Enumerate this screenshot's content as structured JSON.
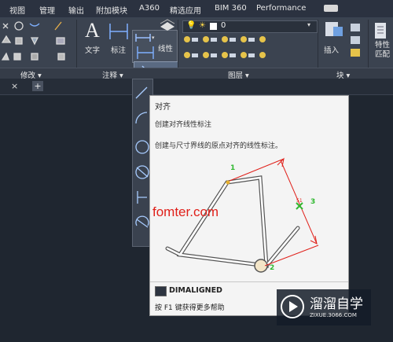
{
  "menu_tabs": [
    "视图",
    "管理",
    "输出",
    "附加模块",
    "A360",
    "精选应用",
    "BIM 360",
    "Performance"
  ],
  "ribbon": {
    "panels": [
      {
        "label": "修改 ▾"
      },
      {
        "label": "注释 ▾"
      },
      {
        "label": "图层 ▾"
      },
      {
        "label": "块 ▾"
      }
    ],
    "text_label": "文字",
    "dim_label": "标注",
    "linear_label": "线性",
    "align_label": "对齐",
    "insert_label": "插入",
    "props_label": "特性\n匹配",
    "layer_current": "0"
  },
  "doc_tab_close": "×",
  "doc_tab_add": "+",
  "tooltip": {
    "title": "对齐",
    "subtitle": "创建对齐线性标注",
    "description": "创建与尺寸界线的原点对齐的线性标注。",
    "command": "DIMALIGNED",
    "help": "按 F1 键获得更多帮助",
    "marker_1": "1",
    "marker_2": "2",
    "marker_3": "3",
    "dim_value": "51"
  },
  "watermark": "fomter.com",
  "brand": {
    "name": "溜溜自学",
    "url": "ZIXUE.3066.COM"
  },
  "colors": {
    "accent": "#e0201a",
    "marker": "#2fb82f",
    "tooltip_bg": "#f4f4f4",
    "ribbon_bg": "#3b4350",
    "canvas_bg": "#1f2630"
  }
}
